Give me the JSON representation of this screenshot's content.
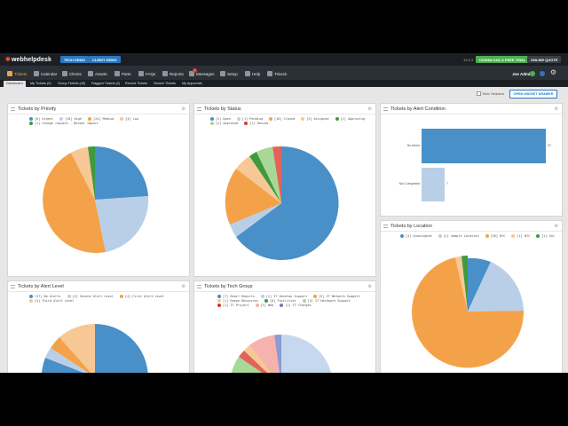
{
  "app": {
    "logo_text": "webhelpdesk",
    "demo_buttons": [
      "TECH DEMO",
      "CLIENT DEMO"
    ],
    "version": "12.6.3",
    "right_buttons": [
      "DOWNLOAD A FREE TRIAL",
      "ONLINE QUOTE"
    ],
    "user": "Joe Admin"
  },
  "menu": [
    {
      "label": "Tickets",
      "icon": "tickets-icon"
    },
    {
      "label": "Calendar",
      "icon": "calendar-icon"
    },
    {
      "label": "Clients",
      "icon": "clients-icon"
    },
    {
      "label": "Assets",
      "icon": "assets-icon"
    },
    {
      "label": "Parts",
      "icon": "parts-icon"
    },
    {
      "label": "FAQs",
      "icon": "faqs-icon"
    },
    {
      "label": "Reports",
      "icon": "reports-icon"
    },
    {
      "label": "Messages",
      "icon": "messages-icon"
    },
    {
      "label": "Setup",
      "icon": "setup-icon"
    },
    {
      "label": "Help",
      "icon": "help-icon"
    },
    {
      "label": "Timeck",
      "icon": "clock-icon"
    }
  ],
  "messages_badge": "1",
  "tabs": [
    "Dashboard",
    "My Tickets (9)",
    "Group Tickets (43)",
    "Flagged Tickets (2)",
    "Recent Tickets",
    "Search Tickets",
    "My Approvals"
  ],
  "toolbar": {
    "hide_headers": "Hide Headers",
    "widget_button": "OPEN WIDGET DRAWER"
  },
  "widgets": {
    "priority": {
      "title": "Tickets by Priority",
      "legend": [
        {
          "label": "[6] Urgent",
          "color": "#4a90c8"
        },
        {
          "label": "[10] High",
          "color": "#b9cfe8"
        },
        {
          "label": "[24] Medium",
          "color": "#f4a24a"
        },
        {
          "label": "[3] Low",
          "color": "#f7c896"
        },
        {
          "label": "[1] Change request - Normal Impact",
          "color": "#3f9a3f"
        }
      ]
    },
    "status": {
      "title": "Tickets by Status",
      "legend": [
        {
          "label": "[2] Open",
          "color": "#4a90c8"
        },
        {
          "label": "[1] Pending",
          "color": "#b9cfe8"
        },
        {
          "label": "[16] Closed",
          "color": "#f4a24a"
        },
        {
          "label": "[3] Assigned",
          "color": "#f7c896"
        },
        {
          "label": "[1] Approving",
          "color": "#3f9a3f"
        },
        {
          "label": "[2] Approved",
          "color": "#a8d898"
        },
        {
          "label": "[1] Denied",
          "color": "#d9372f"
        }
      ]
    },
    "alert_condition": {
      "title": "Tickets by Alert Condition",
      "bars": [
        {
          "label": "No Alerts",
          "value": "37"
        },
        {
          "label": "Not Completed",
          "value": "7"
        }
      ]
    },
    "location": {
      "title": "Tickets by Location",
      "legend": [
        {
          "label": "[4] Unassigned",
          "color": "#4a90c8"
        },
        {
          "label": "[1] Sample Location",
          "color": "#b9cfe8"
        },
        {
          "label": "[36] NYC",
          "color": "#f4a24a"
        },
        {
          "label": "[1] NYC",
          "color": "#f7c896"
        },
        {
          "label": "[1] Ont",
          "color": "#3f9a3f"
        }
      ]
    },
    "alert_level": {
      "title": "Tickets by Alert Level",
      "legend": [
        {
          "label": "[37] No Alerts",
          "color": "#4a90c8"
        },
        {
          "label": "[2] Second Alert Level",
          "color": "#b9cfe8"
        },
        {
          "label": "[4] First Alert Level",
          "color": "#f4a24a"
        },
        {
          "label": "[4] Third Alert Level",
          "color": "#f7c896"
        }
      ]
    },
    "tech_group": {
      "title": "Tickets by Tech Group",
      "legend": [
        {
          "label": "[7] Email Reports",
          "color": "#4a90c8"
        },
        {
          "label": "[1] IT Desktop Support",
          "color": "#b9cfe8"
        },
        {
          "label": "[5] IT Network Support",
          "color": "#f4a24a"
        },
        {
          "label": "[1] Human Resources",
          "color": "#f7c896"
        },
        {
          "label": "[8] Facilities",
          "color": "#3f9a3f"
        },
        {
          "label": "[3] IT Hardware Support",
          "color": "#a8d898"
        },
        {
          "label": "[1] IT Project",
          "color": "#d9372f"
        },
        {
          "label": "[1] Web",
          "color": "#f6b3ad"
        },
        {
          "label": "[1] IT Changes",
          "color": "#8d6db3"
        }
      ]
    }
  }
}
